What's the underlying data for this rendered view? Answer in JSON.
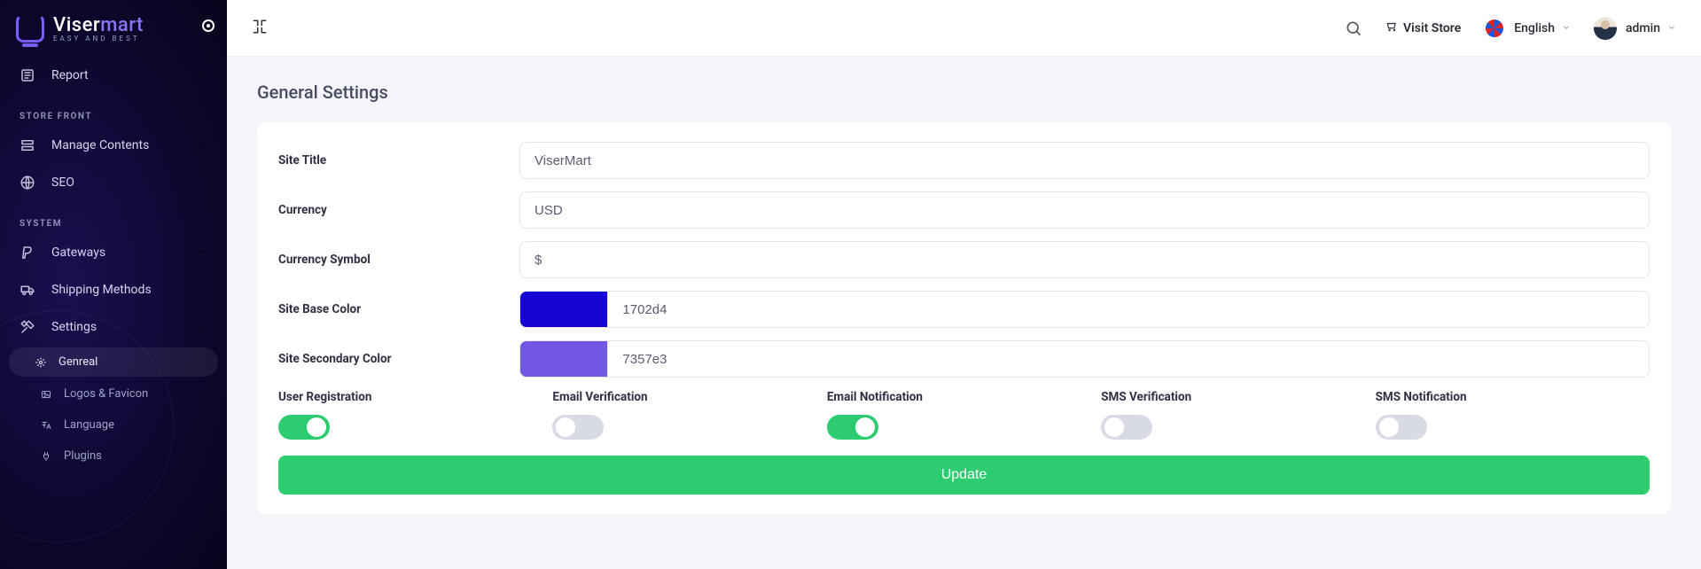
{
  "brand": {
    "name1": "Viser",
    "name2": "mart",
    "tagline": "Easy and Best"
  },
  "header": {
    "visit_store": "Visit Store",
    "language": "English",
    "user": "admin"
  },
  "sidebar": {
    "report": "Report",
    "sec_storefront": "STORE FRONT",
    "manage_contents": "Manage Contents",
    "seo": "SEO",
    "sec_system": "SYSTEM",
    "gateways": "Gateways",
    "shipping": "Shipping Methods",
    "settings": "Settings",
    "sub_general": "Genreal",
    "sub_logos": "Logos & Favicon",
    "sub_language": "Language",
    "sub_plugins": "Plugins"
  },
  "page": {
    "title": "General Settings"
  },
  "form": {
    "site_title_label": "Site Title",
    "site_title_value": "ViserMart",
    "currency_label": "Currency",
    "currency_value": "USD",
    "currency_symbol_label": "Currency Symbol",
    "currency_symbol_value": "$",
    "base_color_label": "Site Base Color",
    "base_color_value": "1702d4",
    "base_color_hex": "#1702d4",
    "secondary_color_label": "Site Secondary Color",
    "secondary_color_value": "7357e3",
    "secondary_color_hex": "#7357e3",
    "toggles": {
      "user_registration": {
        "label": "User Registration",
        "on": true
      },
      "email_verification": {
        "label": "Email Verification",
        "on": false
      },
      "email_notification": {
        "label": "Email Notification",
        "on": true
      },
      "sms_verification": {
        "label": "SMS Verification",
        "on": false
      },
      "sms_notification": {
        "label": "SMS Notification",
        "on": false
      }
    },
    "update_btn": "Update"
  }
}
